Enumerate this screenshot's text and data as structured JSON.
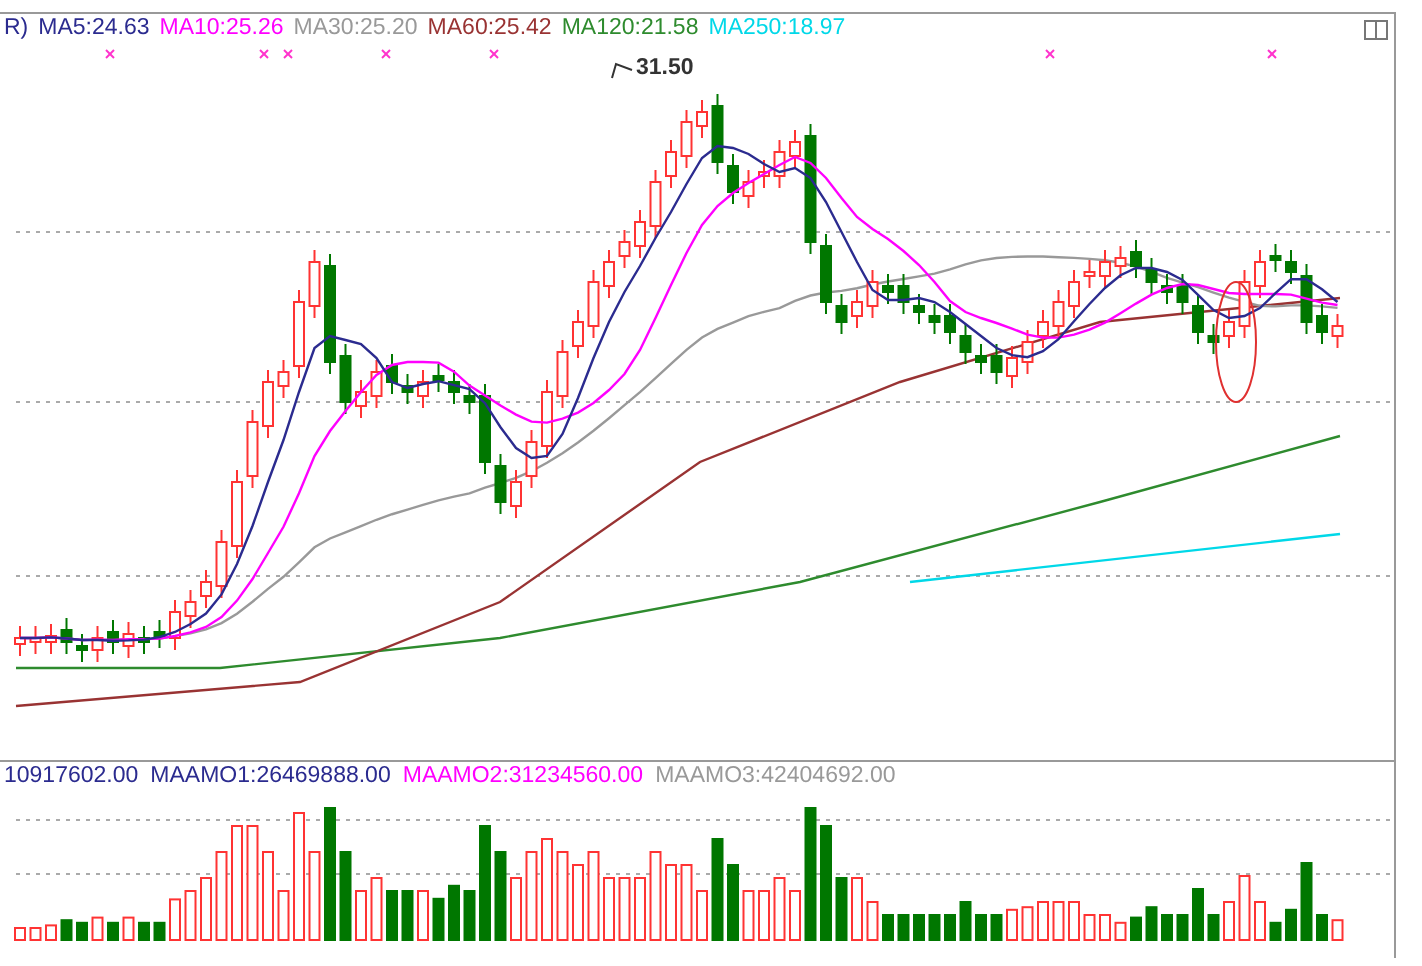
{
  "price_legend": {
    "prefix": "R)",
    "items": [
      {
        "label": "MA5:24.63",
        "color": "#2b2b8f"
      },
      {
        "label": "MA10:25.26",
        "color": "#ff00ff"
      },
      {
        "label": "MA30:25.20",
        "color": "#999999"
      },
      {
        "label": "MA60:25.42",
        "color": "#993333"
      },
      {
        "label": "MA120:21.58",
        "color": "#2e8b2e"
      },
      {
        "label": "MA250:18.97",
        "color": "#00d8e8"
      }
    ]
  },
  "peak_label": "31.50",
  "volume_legend": {
    "items": [
      {
        "label": "10917602.00",
        "color": "#2b2b8f"
      },
      {
        "label": "MAAMO1:26469888.00",
        "color": "#2b2b8f"
      },
      {
        "label": "MAAMO2:31234560.00",
        "color": "#ff00ff"
      },
      {
        "label": "MAAMO3:42404692.00",
        "color": "#999999"
      }
    ]
  }
}
